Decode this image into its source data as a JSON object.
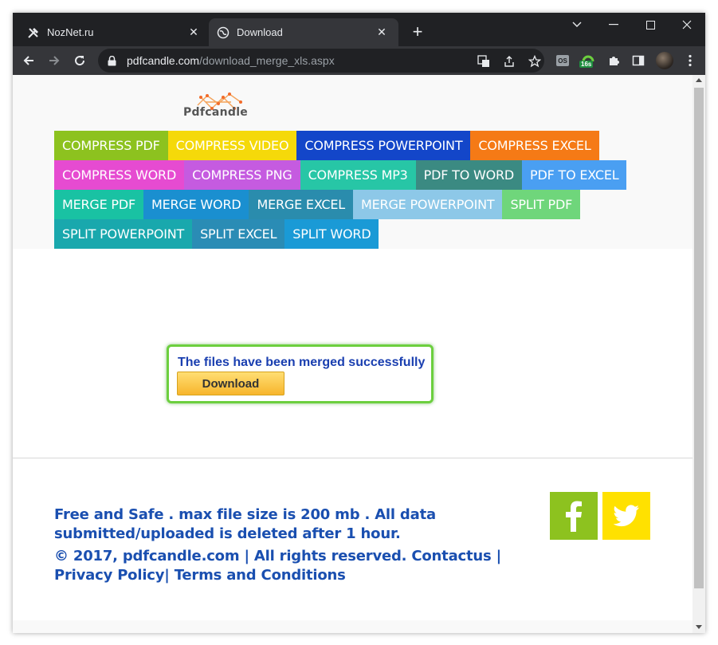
{
  "browser": {
    "tabs": [
      {
        "title": "NozNet.ru",
        "icon": "tools-icon",
        "active": false
      },
      {
        "title": "Download",
        "icon": "globe-icon",
        "active": true
      }
    ],
    "url_host": "pdfcandle.com",
    "url_path": "/download_merge_xls.aspx",
    "extension_badge": "16s",
    "extension_label": "OS"
  },
  "site": {
    "logo_text": "Pdfcandle",
    "nav_rows": [
      [
        {
          "label": "COMPRESS PDF",
          "color": "#8dc21f"
        },
        {
          "label": "COMPRESS VIDEO",
          "color": "#f5d90a"
        },
        {
          "label": "COMPRESS POWERPOINT",
          "color": "#1346c9"
        },
        {
          "label": "COMPRESS EXCEL",
          "color": "#f57a16"
        }
      ],
      [
        {
          "label": "COMPRESS WORD",
          "color": "#e64bd1"
        },
        {
          "label": "COMPRESS PNG",
          "color": "#c55be0"
        },
        {
          "label": "COMPRESS MP3",
          "color": "#27c6a6"
        },
        {
          "label": "PDF TO WORD",
          "color": "#3b8a82"
        },
        {
          "label": "PDF TO EXCEL",
          "color": "#4a9ff2"
        }
      ],
      [
        {
          "label": "MERGE PDF",
          "color": "#19c2a3"
        },
        {
          "label": "MERGE WORD",
          "color": "#1a8fd0"
        },
        {
          "label": "MERGE EXCEL",
          "color": "#2a8cad"
        },
        {
          "label": "MERGE POWERPOINT",
          "color": "#8dc8e8"
        },
        {
          "label": "SPLIT PDF",
          "color": "#6fd67b"
        }
      ],
      [
        {
          "label": "SPLIT POWERPOINT",
          "color": "#19a8ad"
        },
        {
          "label": "SPLIT EXCEL",
          "color": "#2a8cb5"
        },
        {
          "label": "SPLIT WORD",
          "color": "#1a9ad6"
        }
      ]
    ],
    "result_message": "The files have been merged successfully",
    "download_label": "Download",
    "footer_line1": "Free and Safe . max file size is 200 mb . All data submitted/uploaded is deleted after 1 hour.",
    "footer_line2": "© 2017, pdfcandle.com | All rights reserved. Contactus | Privacy Policy| Terms and Conditions",
    "social": [
      {
        "icon": "facebook-icon",
        "color": "#8dc21f",
        "glyph": "f"
      },
      {
        "icon": "twitter-icon",
        "color": "#ffe100",
        "glyph": ""
      }
    ]
  }
}
